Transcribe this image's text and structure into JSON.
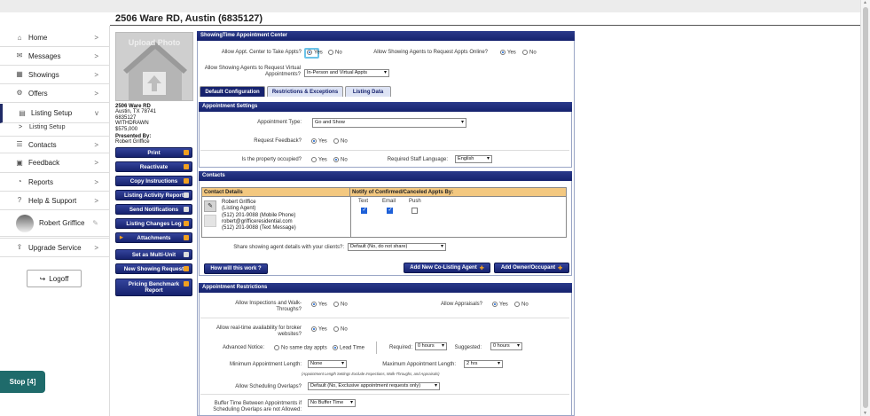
{
  "property_title": "2506 Ware RD, Austin (6835127)",
  "sidebar": {
    "items": [
      {
        "label": "Home",
        "icon": "home-icon",
        "glyph": "⌂"
      },
      {
        "label": "Messages",
        "icon": "envelope-icon",
        "glyph": "✉"
      },
      {
        "label": "Showings",
        "icon": "calendar-icon",
        "glyph": "▦"
      },
      {
        "label": "Offers",
        "icon": "gear-icon",
        "glyph": "⚙"
      },
      {
        "label": "Listing Setup",
        "icon": "clipboard-icon",
        "glyph": "▤"
      },
      {
        "label": "Contacts",
        "icon": "contacts-icon",
        "glyph": "☰"
      },
      {
        "label": "Feedback",
        "icon": "feedback-icon",
        "glyph": "▣"
      },
      {
        "label": "Reports",
        "icon": "chart-icon",
        "glyph": "◔"
      },
      {
        "label": "Help & Support",
        "icon": "help-icon",
        "glyph": "?"
      },
      {
        "label": "Upgrade Service",
        "icon": "upgrade-icon",
        "glyph": "⇪"
      }
    ],
    "chevron": ">",
    "chevron_open": "v",
    "sub_item_prefix": ">",
    "sub_item": "Listing Setup",
    "user_name": "Robert Griffice",
    "logout_label": "Logoff"
  },
  "stop_button": "Stop [4]",
  "photo": {
    "upload_label": "Upload Photo"
  },
  "listing_info": {
    "line1": "2506 Ware RD",
    "line2": "Austin, TX 78741",
    "line3": "6835127",
    "line4": "WITHDRAWN",
    "line5": "$575,000",
    "presented_label": "Presented By:",
    "presenter": "Robert Griffice"
  },
  "actions": [
    "Print",
    "Reactivate",
    "Copy Instructions",
    "Listing Activity Report",
    "Send Notifications",
    "Listing Changes Log",
    "Attachments",
    "Set as Multi-Unit",
    "New Showing Request",
    "Pricing Benchmark Report"
  ],
  "center": {
    "header": "ShowingTime Appointment Center",
    "allow_appt_label": "Allow Appt. Center to Take Appts?",
    "allow_online_label": "Allow Showing Agents to Request Appts Online?",
    "virtual_label": "Allow Showing Agents to Request Virtual Appointments?",
    "virtual_value": "In-Person and Virtual Appts",
    "yes": "Yes",
    "no": "No"
  },
  "tabs": [
    "Default Configuration",
    "Restrictions & Exceptions",
    "Listing Data"
  ],
  "appointment_settings": {
    "header": "Appointment Settings",
    "type_label": "Appointment Type:",
    "type_value": "Go and Show",
    "feedback_label": "Request Feedback?",
    "occupied_label": "Is the property occupied?",
    "language_label": "Required Staff Language:",
    "language_value": "English"
  },
  "contacts": {
    "header": "Contacts",
    "col_details": "Contact Details",
    "col_notify": "Notify of Confirmed/Canceled Appts By:",
    "notify_cols": [
      "Text",
      "Email",
      "Push"
    ],
    "contact_name": "Robert Griffice",
    "contact_role": "(Listing Agent)",
    "contact_phone": "(512) 201-9088 (Mobile Phone)",
    "contact_email": "robert@grifficeresidential.com",
    "contact_text": "(512) 201-9088 (Text Message)",
    "share_label": "Share showing agent details with your clients?:",
    "share_value": "Default (No, do not share)",
    "how_button": "How will this work ?",
    "add_colisting": "Add New Co-Listing Agent",
    "add_owner": "Add Owner/Occupant"
  },
  "restrictions": {
    "header": "Appointment Restrictions",
    "inspections_label": "Allow Inspections and Walk-Throughs?",
    "appraisals_label": "Allow Appraisals?",
    "realtime_label": "Allow real-time availability for broker websites?",
    "notice_label": "Advanced Notice:",
    "no_same_day": "No same day appts",
    "lead_time": "Lead Time",
    "required_label": "Required:",
    "required_value": "0 hours",
    "suggested_label": "Suggested:",
    "suggested_value": "0 hours",
    "min_label": "Minimum Appointment Length:",
    "min_value": "None",
    "max_label": "Maximum Appointment Length:",
    "max_value": "2 hrs",
    "length_note": "(Appointment Length Settings Exclude Inspections, Walk-Throughs, and Appraisals)",
    "overlap_label": "Allow Scheduling Overlaps?",
    "overlap_value": "Default (No, Exclusive appointment requests only)",
    "buffer_label": "Buffer Time Between Appointments if Scheduling Overlaps are not Allowed:",
    "buffer_value": "No Buffer Time"
  }
}
